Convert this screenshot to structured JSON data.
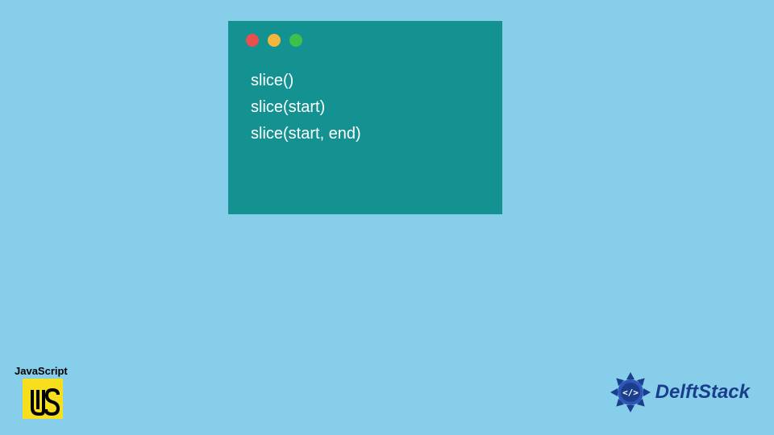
{
  "colors": {
    "background": "#87CEEB",
    "window": "#149292",
    "dot_red": "#E94F4F",
    "dot_yellow": "#F4B63F",
    "dot_green": "#3CC24A",
    "js_yellow": "#F7DF1E",
    "delft_blue": "#1b3e8c"
  },
  "code": {
    "lines": [
      "slice()",
      "slice(start)",
      "slice(start, end)"
    ]
  },
  "js": {
    "label": "JavaScript",
    "logo_text": "JS"
  },
  "delft": {
    "text": "DelftStack",
    "badge": "</>"
  }
}
